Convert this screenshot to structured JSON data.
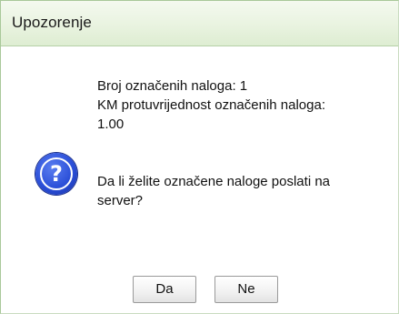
{
  "window": {
    "title": "Upozorenje"
  },
  "message": {
    "line1": "Broj označenih naloga: 1",
    "line2": "KM protuvrijednost označenih naloga:",
    "line3": "1.00",
    "question_line1": "Da li želite označene naloge poslati na",
    "question_line2": "server?"
  },
  "icon": {
    "name": "question-icon",
    "glyph": "?"
  },
  "buttons": {
    "yes_label": "Da",
    "no_label": "Ne"
  },
  "colors": {
    "titlebar": "#e9f3e0",
    "border": "#a9c89a",
    "icon_blue": "#2b4fd8"
  }
}
